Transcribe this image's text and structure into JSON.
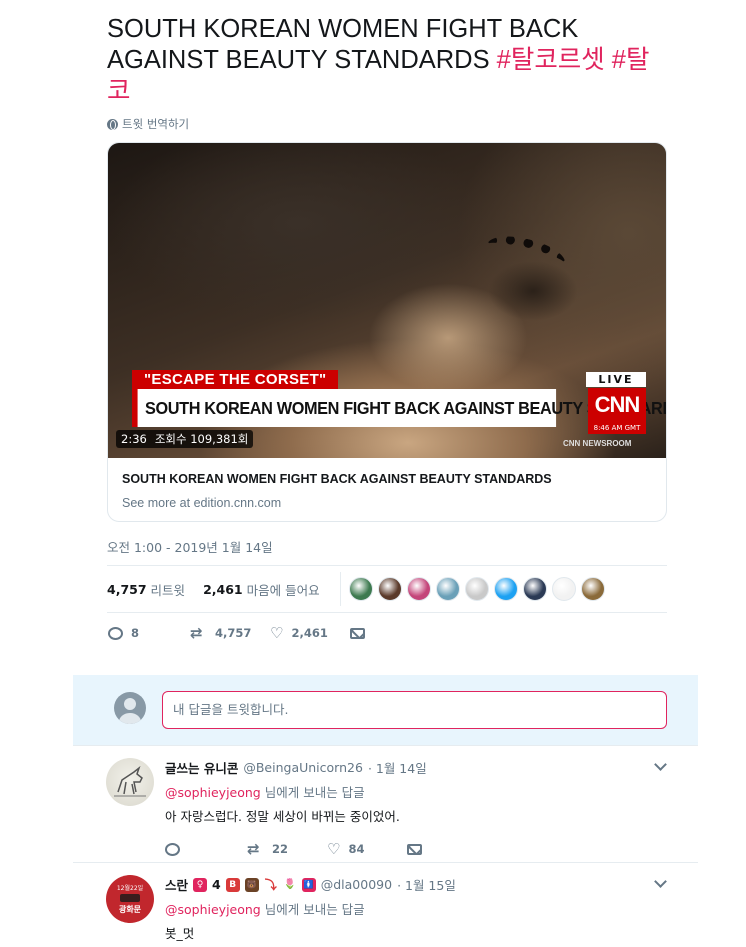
{
  "tweet": {
    "text": "SOUTH KOREAN WOMEN FIGHT BACK AGAINST BEAUTY STANDARDS ",
    "hashtags": [
      "#탈코르셋",
      "#탈코"
    ],
    "translate_label": "트윗 번역하기",
    "timestamp": "오전 1:00 - 2019년 1월 14일"
  },
  "media": {
    "escape_tag": "\"ESCAPE THE CORSET\"",
    "headline": "SOUTH KOREAN WOMEN FIGHT BACK AGAINST BEAUTY STANDARDS",
    "live": "LIVE",
    "network": "CNN",
    "clock": "8:46 AM GMT",
    "newsroom": "CNN NEWSROOM",
    "duration": "2:36",
    "views": "조회수 109,381회"
  },
  "card": {
    "title": "SOUTH KOREAN WOMEN FIGHT BACK AGAINST BEAUTY STANDARDS",
    "domain": "See more at edition.cnn.com"
  },
  "stats": {
    "retweets_count": "4,757",
    "retweets_label": "리트윗",
    "likes_count": "2,461",
    "likes_label": "마음에 들어요",
    "liker_colors": [
      "#3d7a4f",
      "#5b3a2a",
      "#c4457a",
      "#6aa0b8",
      "#c9c9c9",
      "#1da1f2",
      "#2b3a55",
      "#f2f2f2",
      "#8a6a3a"
    ]
  },
  "actions": {
    "replies": "8",
    "retweets": "4,757",
    "likes": "2,461"
  },
  "reply_box": {
    "placeholder": "내 답글을 트윗합니다."
  },
  "replies": [
    {
      "name": "글쓰는 유니콘",
      "handle": "@BeingaUnicorn26",
      "date": "· 1월 14일",
      "mention": "@sophieyjeong",
      "to_suffix": " 님에게 보내는 답글",
      "text": "아 자랑스럽다. 정말 세상이 바뀌는 중이었어.",
      "retweets": "22",
      "likes": "84"
    },
    {
      "name": "스란",
      "name_badges": [
        "♀",
        "4",
        "B",
        "🐻",
        "⤵",
        "🌷",
        "🚺"
      ],
      "handle": "@dla00090",
      "date": "· 1월 15일",
      "mention": "@sophieyjeong",
      "to_suffix": " 님에게 보내는 답글",
      "text": "봇_멋",
      "avatar_lines": [
        "12월22일",
        "광화문"
      ]
    }
  ]
}
